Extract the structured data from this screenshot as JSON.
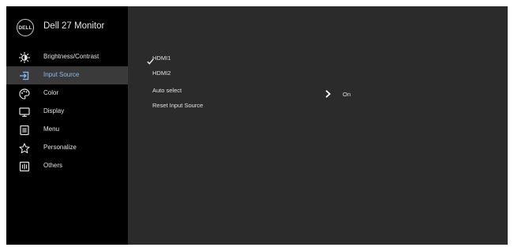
{
  "brand": {
    "logo_text": "DELL",
    "model": "Dell 27 Monitor"
  },
  "menu": [
    {
      "label": "Brightness/Contrast",
      "icon": "brightness-icon"
    },
    {
      "label": "Input Source",
      "icon": "input-source-icon",
      "selected": true
    },
    {
      "label": "Color",
      "icon": "color-palette-icon"
    },
    {
      "label": "Display",
      "icon": "display-monitor-icon"
    },
    {
      "label": "Menu",
      "icon": "menu-list-icon"
    },
    {
      "label": "Personalize",
      "icon": "star-icon"
    },
    {
      "label": "Others",
      "icon": "others-icon"
    }
  ],
  "submenu": {
    "items": [
      {
        "label": "HDMI1",
        "checked": true
      },
      {
        "label": "HDMI2"
      },
      {
        "label": "Auto select",
        "value": "On"
      },
      {
        "label": "Reset Input Source"
      }
    ]
  },
  "colors": {
    "sidebar_bg": "#000000",
    "panel_bg": "#2b2b2b",
    "selected_bg": "#3a3a3a",
    "selected_text": "#8fb7e6",
    "text": "#e2e2e2"
  }
}
